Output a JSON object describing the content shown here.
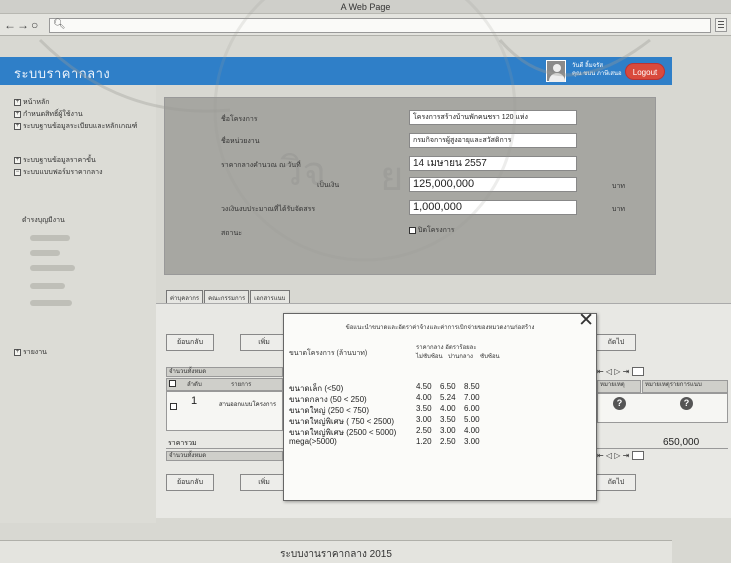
{
  "window": {
    "title": "A Web Page",
    "nav_back": "←",
    "nav_forward": "→",
    "nav_reload": "○",
    "address_icon": "search-icon"
  },
  "app": {
    "title": "ระบบราคากลาง",
    "user_name": "วันดี ลิ้มจรัส",
    "user_role": "คุณ ชบน ภาษีเสนอ",
    "logout_label": "Logout"
  },
  "sidebar": {
    "items": [
      {
        "label": "หน้าหลัก",
        "expander": "+"
      },
      {
        "label": "กำหนดสิทธิ์ผู้ใช้งาน",
        "expander": "+"
      },
      {
        "label": "ระบบฐานข้อมูลระเบียบและหลักเกณฑ์",
        "expander": "+"
      },
      {
        "label": "ระบบฐานข้อมูลราคาขั้น",
        "expander": "+"
      },
      {
        "label": "ระบบแบบฟอร์มราคากลาง",
        "expander": "−"
      },
      {
        "label": "ดำรงบุญมีงาน",
        "expander": ""
      },
      {
        "label": "รายงาน",
        "expander": "+"
      }
    ]
  },
  "form": {
    "project_label": "ชื่อโครงการ",
    "project_value": "โครงการสร้างบ้านพักคนชรา 120 แห่ง",
    "agency_label": "ชื่อหน่วยงาน",
    "agency_value": "กรมกิจการผู้สูงอายุและสวัสดิการ",
    "date_label": "ราคากลางคำนวณ ณ วันที่",
    "date_value": "14 เมษายน 2557",
    "amount_label": "เป็นเงิน",
    "amount_value": "125,000,000",
    "amount_unit": "บาท",
    "budget_label": "วงเงินงบประมาณที่ได้รับจัดสรร",
    "budget_value": "1,000,000",
    "budget_unit": "บาท",
    "status_label": "สถานะ",
    "status_check_label": "ปิดโครงการ"
  },
  "tabs": [
    {
      "label": "ค่าบุคลากร"
    },
    {
      "label": "คณะกรรมการ"
    },
    {
      "label": "เอกสารแนบ"
    }
  ],
  "content": {
    "back_label": "ย้อนกลับ",
    "add_label": "เพิ่ม",
    "next_label": "ถัดไป",
    "grid_title": "จำนวนทั้งหมด",
    "col_no": "ลำดับ",
    "col_item": "รายการ",
    "col_remark": "หมายเหตุ",
    "col_attach": "หมายเหตุรายการแนบ",
    "row1_no": "1",
    "row1_item": "สานออกแบบโครงการ",
    "total_label": "ราคารวม",
    "total_value": "650,000",
    "grid2_title": "จำนวนทั้งหมด",
    "pager": "⇤ ◁ ▷ ⇥",
    "pager_page": "1"
  },
  "modal": {
    "title": "ข้อแนะนำขนาดและอัตราค่าจ้างและค่าการเบิกจ่ายของหมวดงานก่อสร้าง",
    "header_left": "ขนาดโครงการ (ล้านบาท)",
    "header_right_top": "ราคากลาง อัตราร้อยละ",
    "col1": "ไม่ซับซ้อน",
    "col2": "ปานกลาง",
    "col3": "ซับซ้อน",
    "rows": [
      {
        "label": "ขนาดเล็ก (<50)",
        "v1": "4.50",
        "v2": "6.50",
        "v3": "8.50"
      },
      {
        "label": "ขนาดกลาง (50 < 250)",
        "v1": "4.00",
        "v2": "5.24",
        "v3": "7.00"
      },
      {
        "label": "ขนาดใหญ่ (250 < 750)",
        "v1": "3.50",
        "v2": "4.00",
        "v3": "6.00"
      },
      {
        "label": "ขนาดใหญ่พิเศษ ( 750 < 2500)",
        "v1": "3.00",
        "v2": "3.50",
        "v3": "5.00"
      },
      {
        "label": "ขนาดใหญ่พิเศษ (2500 < 5000)",
        "v1": "2.50",
        "v2": "3.00",
        "v3": "4.00"
      },
      {
        "label": "mega(>5000)",
        "v1": "1.20",
        "v2": "2.50",
        "v3": "3.00"
      }
    ],
    "close_icon": "close-icon"
  },
  "footer": {
    "text": "ระบบงานราคากลาง 2015"
  },
  "colors": {
    "header_blue": "#2f7fc8",
    "logout_red": "#d94a3c",
    "form_panel": "#a7a7a2"
  }
}
